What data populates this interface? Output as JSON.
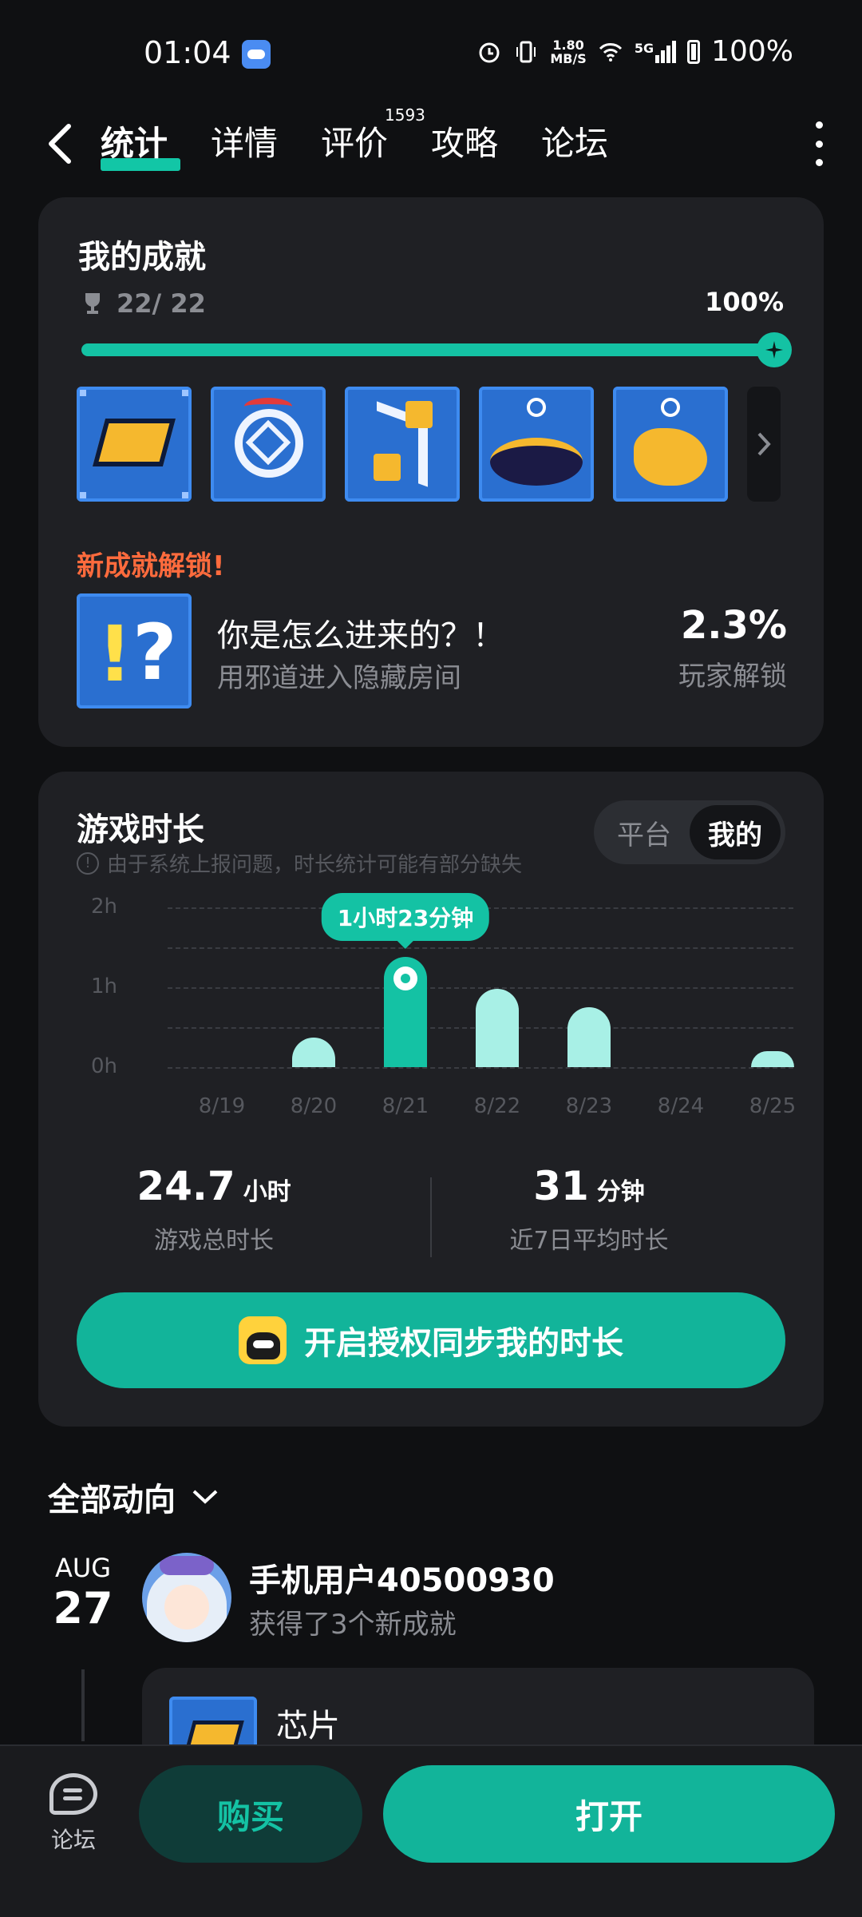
{
  "status_bar": {
    "time": "01:04",
    "net_speed_value": "1.80",
    "net_speed_unit": "MB/S",
    "network": "5G",
    "battery": "100%"
  },
  "nav": {
    "tabs": [
      {
        "label": "统计",
        "active": true
      },
      {
        "label": "详情"
      },
      {
        "label": "评价",
        "badge": "1593"
      },
      {
        "label": "攻略"
      },
      {
        "label": "论坛"
      }
    ]
  },
  "achievements": {
    "title": "我的成就",
    "count": "22/ 22",
    "percent": "100%",
    "progress": 1.0,
    "new_unlocked_label": "新成就解锁!",
    "latest": {
      "name": "你是怎么进来的？！",
      "desc": "用邪道进入隐藏房间",
      "rate": "2.3%",
      "rate_label": "玩家解锁"
    }
  },
  "playtime": {
    "title": "游戏时长",
    "note": "由于系统上报问题，时长统计可能有部分缺失",
    "segments": [
      "平台",
      "我的"
    ],
    "active_segment": "我的",
    "total_value": "24.7",
    "total_unit": "小时",
    "total_label": "游戏总时长",
    "avg_value": "31",
    "avg_unit": "分钟",
    "avg_label": "近7日平均时长",
    "sync_button": "开启授权同步我的时长",
    "tooltip": "1小时23分钟"
  },
  "chart_data": {
    "type": "bar",
    "categories": [
      "8/19",
      "8/20",
      "8/21",
      "8/22",
      "8/23",
      "8/24",
      "8/25"
    ],
    "values": [
      0,
      0.37,
      1.38,
      0.98,
      0.75,
      0,
      0.2
    ],
    "y_ticks": [
      "0h",
      "1h",
      "2h"
    ],
    "ylim": [
      0,
      2
    ],
    "highlight_index": 2,
    "grid": true
  },
  "feed": {
    "header": "全部动向",
    "month": "AUG",
    "day": "27",
    "user": "手机用户40500930",
    "action": "获得了3个新成就",
    "item_name": "芯片"
  },
  "bottom": {
    "forum_label": "论坛",
    "buy_label": "购买",
    "open_label": "打开"
  },
  "colors": {
    "accent": "#14c2a4",
    "highlight_orange": "#ff6b3d",
    "card_bg": "#1f2024",
    "page_bg": "#0f1012"
  }
}
